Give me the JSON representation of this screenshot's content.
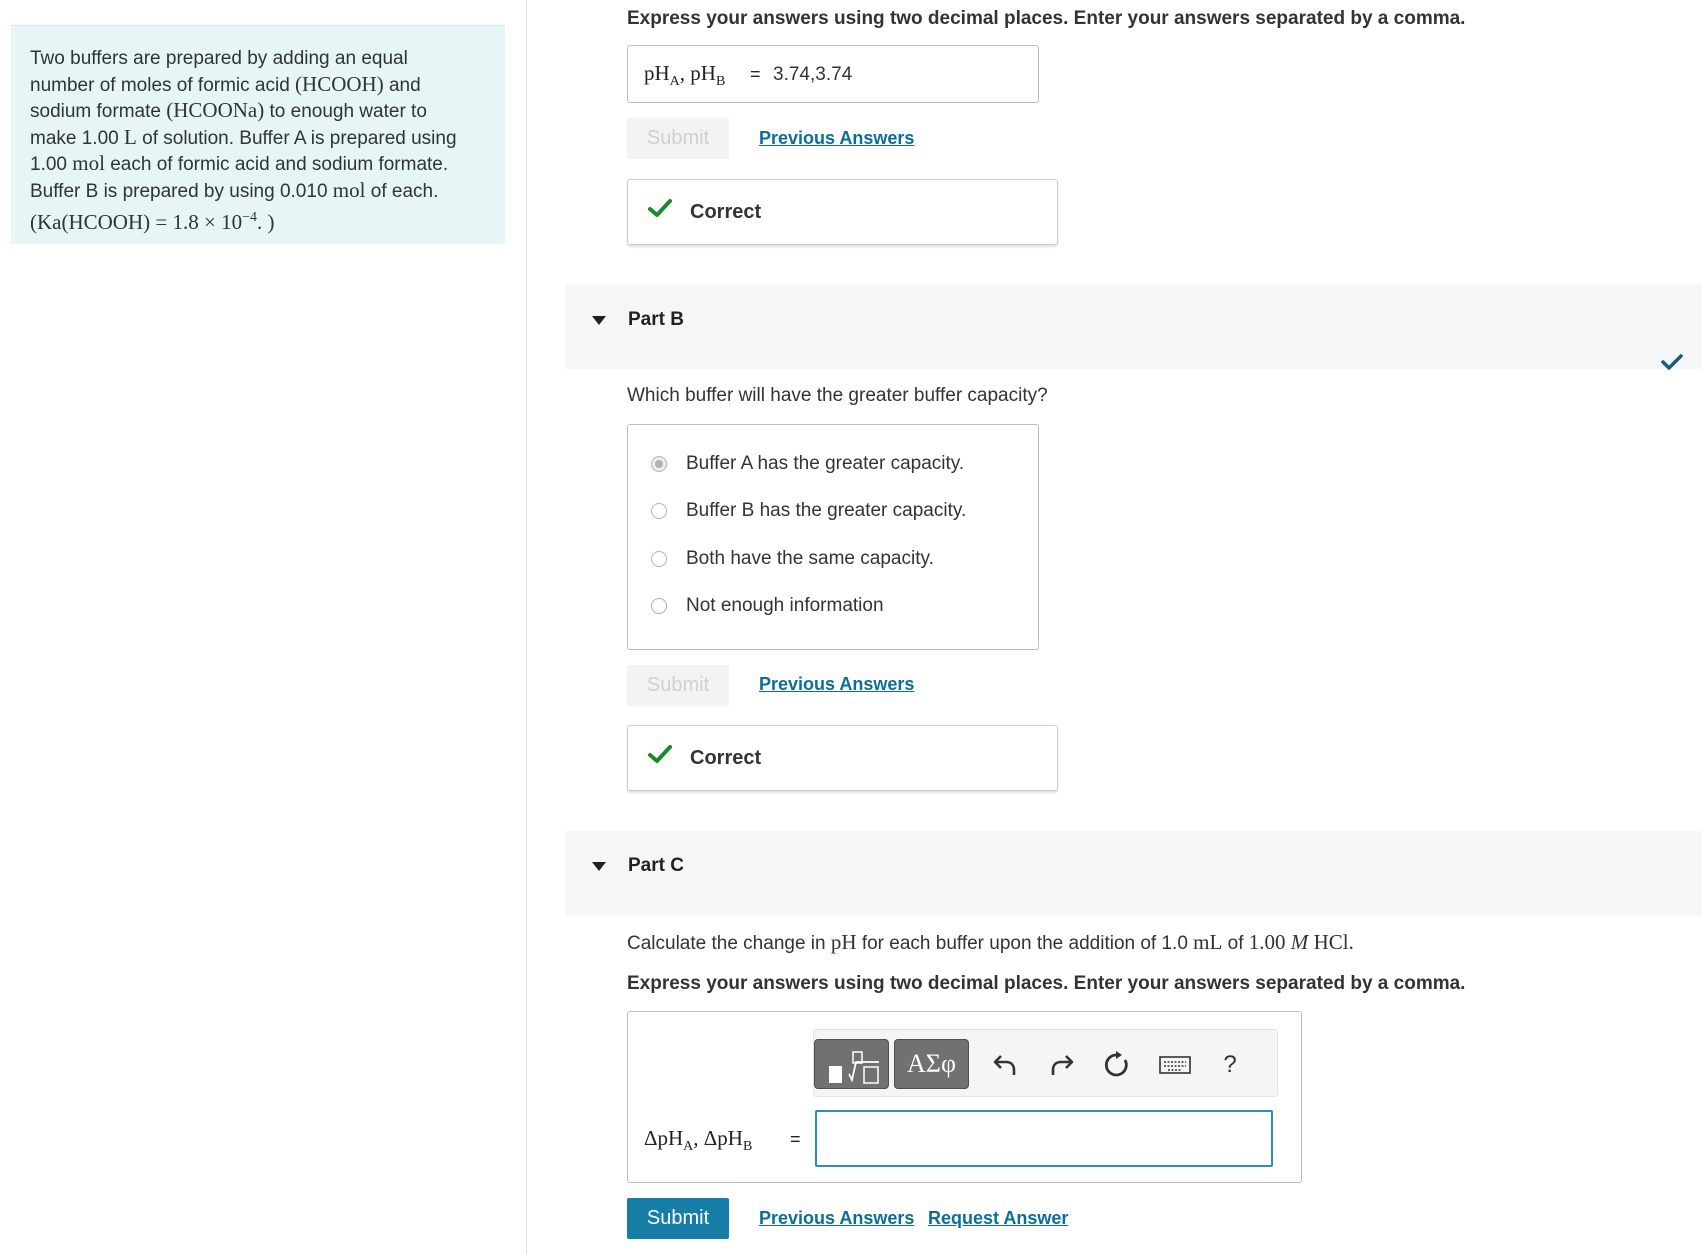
{
  "problem": {
    "lines": [
      "Two buffers are prepared by adding an equal",
      "number of moles of formic acid",
      "(HCOOH)",
      "and",
      "sodium formate",
      "(HCOONa)",
      "to enough water to",
      "make 1.00",
      "L",
      "of solution. Buffer A is prepared using",
      "1.00",
      "mol",
      "each of formic acid and sodium formate.",
      "Buffer B is prepared by using 0.010",
      "mol",
      "of each.",
      "(Ka(HCOOH) = 1.8 × 10",
      "−4",
      ". )"
    ]
  },
  "partA": {
    "instruction": "Express your answers using two decimal places. Enter your answers separated by a comma.",
    "answer_label": "pH",
    "sub_a": "A",
    "sep": ", pH",
    "sub_b": "B",
    "equals": "=",
    "answer_value": "3.74,3.74",
    "submit_label": "Submit",
    "previous_label": "Previous Answers",
    "feedback": "Correct"
  },
  "partB": {
    "title": "Part B",
    "question": "Which buffer will have the greater buffer capacity?",
    "options": [
      "Buffer A has the greater capacity.",
      "Buffer B has the greater capacity.",
      "Both have the same capacity.",
      "Not enough information"
    ],
    "submit_label": "Submit",
    "previous_label": "Previous Answers",
    "feedback": "Correct"
  },
  "partC": {
    "title": "Part C",
    "question_pre": "Calculate the change in",
    "question_ph": "pH",
    "question_mid": "for each buffer upon the addition of 1.0",
    "question_ml": "mL",
    "question_of": "of",
    "question_conc": "1.00",
    "question_m": "M",
    "question_hcl": "HCl.",
    "instruction": "Express your answers using two decimal places. Enter your answers separated by a comma.",
    "answer_label": "ΔpH",
    "sub_a": "A",
    "sep": ", ΔpH",
    "sub_b": "B",
    "equals": "=",
    "answer_value": "",
    "greek_label": "ΑΣφ",
    "help_label": "?",
    "submit_label": "Submit",
    "previous_label": "Previous Answers",
    "request_label": "Request Answer"
  },
  "colors": {
    "accent": "#167ea6",
    "correct_green": "#1a8a2a",
    "link": "#0b6e99"
  }
}
